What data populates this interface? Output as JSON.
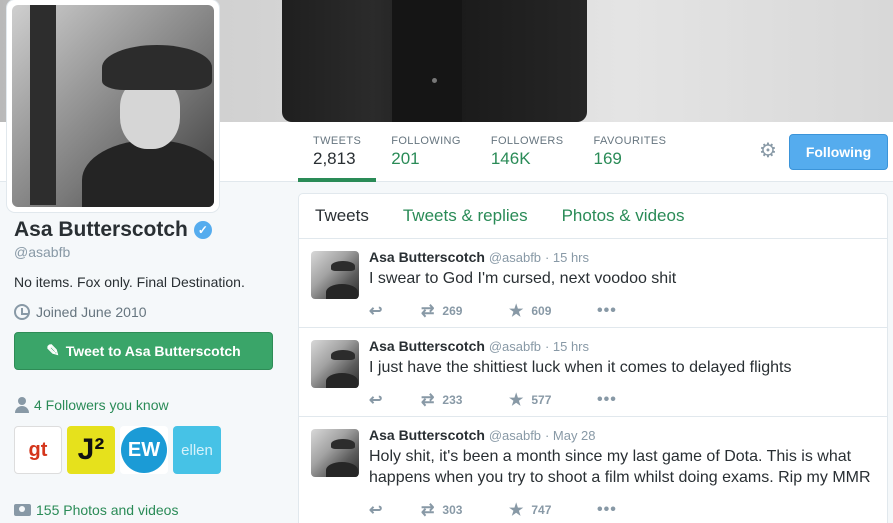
{
  "profile": {
    "name": "Asa Butterscotch",
    "handle": "@asabfb",
    "bio": "No items. Fox only. Final Destination.",
    "joined": "Joined June 2010",
    "tweet_to_label": "Tweet to Asa Butterscotch",
    "followers_you_know": "4 Followers you know",
    "photos_videos": "155 Photos and videos",
    "followers_known": [
      {
        "label": "gt",
        "icon": "gt-logo"
      },
      {
        "label": "J²",
        "icon": "j2-logo"
      },
      {
        "label": "EW",
        "icon": "ew-logo"
      },
      {
        "label": "ellen",
        "icon": "ellen-logo"
      }
    ]
  },
  "stats": [
    {
      "label": "TWEETS",
      "value": "2,813"
    },
    {
      "label": "FOLLOWING",
      "value": "201"
    },
    {
      "label": "FOLLOWERS",
      "value": "146K"
    },
    {
      "label": "FAVOURITES",
      "value": "169"
    }
  ],
  "follow_button": "Following",
  "timeline_tabs": [
    "Tweets",
    "Tweets & replies",
    "Photos & videos"
  ],
  "tweets": [
    {
      "name": "Asa Butterscotch",
      "handle": "@asabfb",
      "time": "· 15 hrs",
      "text": "I swear to God I'm cursed, next voodoo shit",
      "retweets": "269",
      "favorites": "609"
    },
    {
      "name": "Asa Butterscotch",
      "handle": "@asabfb",
      "time": "· 15 hrs",
      "text": "I just have the shittiest luck when it comes to delayed flights",
      "retweets": "233",
      "favorites": "577"
    },
    {
      "name": "Asa Butterscotch",
      "handle": "@asabfb",
      "time": "· May 28",
      "text": "Holy shit, it's been a month since my last game of Dota. This is what happens when you try to shoot a film whilst doing exams. Rip my MMR",
      "retweets": "303",
      "favorites": "747"
    }
  ],
  "colors": {
    "accent": "#2a8b57",
    "follow_blue": "#55acee",
    "tweet_to_green": "#3aa569"
  }
}
